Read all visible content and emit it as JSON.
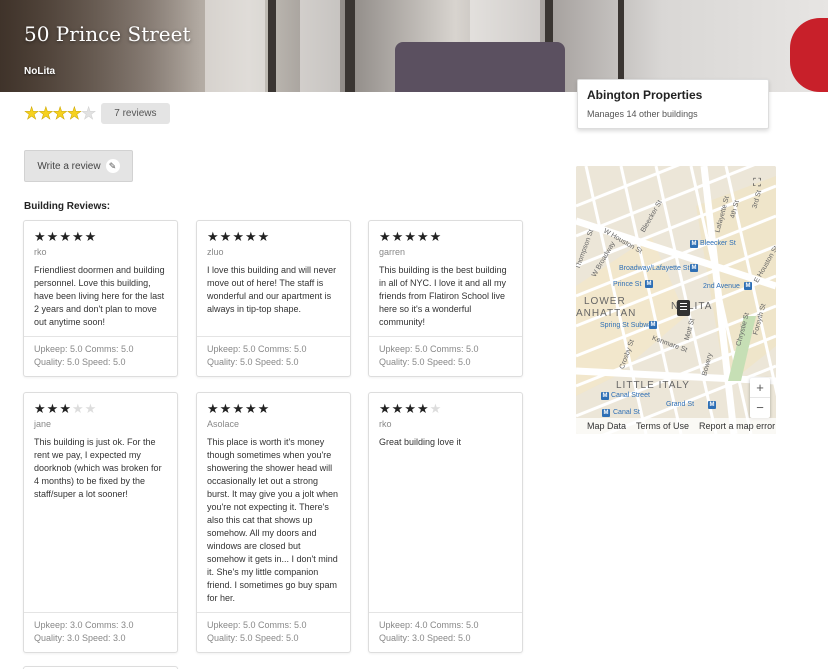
{
  "building": {
    "title": "50 Prince Street",
    "neighborhood": "NoLita"
  },
  "rating": {
    "stars": 4,
    "max": 5,
    "reviews_label": "7 reviews"
  },
  "write_review_label": "Write a review",
  "section_label": "Building Reviews:",
  "reviews": [
    {
      "stars": 5,
      "author": "rko",
      "text": "Friendliest doormen and building personnel. Love this building, have been living here for the last 2 years and don't plan to move out anytime soon!",
      "line1": "Upkeep: 5.0 Comms: 5.0",
      "line2": "Quality: 5.0 Speed: 5.0"
    },
    {
      "stars": 5,
      "author": "zluo",
      "text": "I love this building and will never move out of here! The staff is wonderful and our apartment is always in tip-top shape.",
      "line1": "Upkeep: 5.0 Comms: 5.0",
      "line2": "Quality: 5.0 Speed: 5.0"
    },
    {
      "stars": 5,
      "author": "garren",
      "text": "This building is the best building in all of NYC. I love it and all my friends from Flatiron School live here so it's a wonderful community!",
      "line1": "Upkeep: 5.0 Comms: 5.0",
      "line2": "Quality: 5.0 Speed: 5.0"
    },
    {
      "stars": 3,
      "author": "jane",
      "text": "This building is just ok. For the rent we pay, I expected my doorknob (which was broken for 4 months) to be fixed by the staff/super a lot sooner!",
      "line1": "Upkeep: 3.0 Comms: 3.0",
      "line2": "Quality: 3.0 Speed: 3.0"
    },
    {
      "stars": 5,
      "author": "Asolace",
      "text": "This place is worth it's money though sometimes when you're showering the shower head will occasionally let out a strong burst. It may give you a jolt when you're not expecting it. There's also this cat that shows up somehow. All my doors and windows are closed but somehow it gets in... I don't mind it. She's my little companion friend. I sometimes go buy spam for her.",
      "line1": "Upkeep: 5.0 Comms: 5.0",
      "line2": "Quality: 5.0 Speed: 5.0"
    },
    {
      "stars": 4,
      "author": "rko",
      "text": "Great building love it",
      "line1": "Upkeep: 4.0 Comms: 5.0",
      "line2": "Quality: 3.0 Speed: 5.0"
    }
  ],
  "owner": {
    "name": "Abington Properties",
    "sub": "Manages 14 other buildings"
  },
  "map": {
    "labels": {
      "bleecker": "Bleecker St",
      "w_houston": "W Houston St",
      "w_broadway": "W Broadway",
      "thompson": "Thompson St",
      "bleecker_station": "Bleecker St",
      "broadway_lafayette": "Broadway/Lafayette St",
      "prince": "Prince St",
      "second_ave": "2nd Avenue",
      "lower_manhattan_1": "LOWER",
      "lower_manhattan_2": "ANHATTAN",
      "nolita": "NOLITA",
      "spring_subway": "Spring St Subway",
      "kenmare": "Kenmare St",
      "crosby": "Crosby St",
      "little_italy": "LITTLE ITALY",
      "canal_street": "Canal Street",
      "grand_st": "Grand St",
      "canal_st": "Canal St",
      "bowery": "Bowery",
      "mott": "Mott St",
      "lafayette": "Lafayette St",
      "chrystie": "Chrystie St",
      "forsyth": "Forsyth St",
      "e_houston": "E Houston St",
      "fourth": "4th St",
      "third": "3rd St"
    },
    "zoom_in": "+",
    "zoom_out": "−",
    "footer": [
      "Map Data",
      "Terms of Use",
      "Report a map error"
    ]
  }
}
